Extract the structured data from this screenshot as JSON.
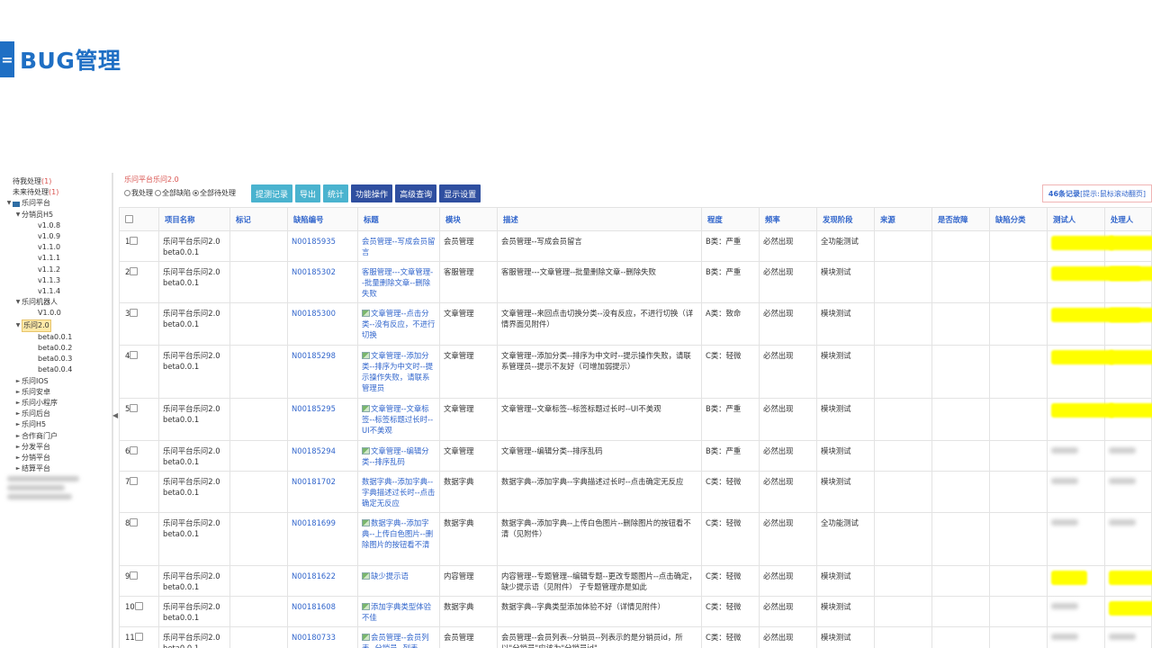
{
  "header": {
    "menu_glyph": "=",
    "title": "BUG管理"
  },
  "tree": {
    "pending_label": "待我处理",
    "pending_count": "(1)",
    "future_label": "未来待处理",
    "future_count": "(1)",
    "root": "乐问平台",
    "g1": "分销员H5",
    "g1_items": [
      "v1.0.8",
      "v1.0.9",
      "v1.1.0",
      "v1.1.1",
      "v1.1.2",
      "v1.1.3",
      "v1.1.4"
    ],
    "g2": "乐问机器人",
    "g2_items": [
      "V1.0.0"
    ],
    "g3": "乐问2.0",
    "g3_items": [
      "beta0.0.1",
      "beta0.0.2",
      "beta0.0.3",
      "beta0.0.4"
    ],
    "others": [
      "乐问IOS",
      "乐问安卓",
      "乐问小程序",
      "乐问后台",
      "乐问H5",
      "合作商门户",
      "分发平台",
      "分销平台",
      "结算平台"
    ]
  },
  "toolbar": {
    "breadcrumb": "乐问平台乐问2.0",
    "radio_mine": "我处理",
    "radio_all_bugs": "全部缺陷",
    "radio_all_pending": "全部待处理",
    "btn_history": "提测记录",
    "btn_export": "导出",
    "btn_stats": "统计",
    "btn_func": "功能操作",
    "btn_advanced": "高级查询",
    "btn_display": "显示设置",
    "records_count": "46条记录",
    "records_hint": "[提示:鼠标滚动翻页]"
  },
  "table": {
    "columns": [
      "项目名称",
      "标记",
      "缺陷编号",
      "标题",
      "模块",
      "描述",
      "程度",
      "频率",
      "发现阶段",
      "来源",
      "是否故障",
      "缺陷分类",
      "测试人",
      "处理人"
    ],
    "rows": [
      {
        "no": "1",
        "project": "乐问平台乐问2.0 beta0.0.1",
        "id": "N00185935",
        "title": "会员管理--写成会员留言",
        "attach": false,
        "module": "会员管理",
        "desc": "会员管理--写成会员留言",
        "level": "B类：严重",
        "freq": "必然出现",
        "stage": "全功能测试"
      },
      {
        "no": "2",
        "project": "乐问平台乐问2.0 beta0.0.1",
        "id": "N00185302",
        "title": "客服管理---文章管理--批量删除文章--删除失败",
        "attach": false,
        "module": "客服管理",
        "desc": "客服管理---文章管理--批量删除文章--删除失败",
        "level": "B类：严重",
        "freq": "必然出现",
        "stage": "模块测试"
      },
      {
        "no": "3",
        "project": "乐问平台乐问2.0 beta0.0.1",
        "id": "N00185300",
        "title": "文章管理--点击分类--没有反应，不进行切换",
        "attach": true,
        "module": "文章管理",
        "desc": "文章管理--来回点击切换分类--没有反应，不进行切换（详情界面见附件）",
        "level": "A类：致命",
        "freq": "必然出现",
        "stage": "模块测试"
      },
      {
        "no": "4",
        "project": "乐问平台乐问2.0 beta0.0.1",
        "id": "N00185298",
        "title": "文章管理--添加分类--排序为中文时--提示操作失败，请联系管理员",
        "attach": true,
        "module": "文章管理",
        "desc": "文章管理--添加分类--排序为中文时--提示操作失败，请联系管理员--提示不友好（可增加弱提示）",
        "level": "C类：轻微",
        "freq": "必然出现",
        "stage": "模块测试"
      },
      {
        "no": "5",
        "project": "乐问平台乐问2.0 beta0.0.1",
        "id": "N00185295",
        "title": "文章管理--文章标签--标签标题过长时--UI不美观",
        "attach": true,
        "module": "文章管理",
        "desc": "文章管理--文章标签--标签标题过长时--UI不美观",
        "level": "B类：严重",
        "freq": "必然出现",
        "stage": "模块测试"
      },
      {
        "no": "6",
        "project": "乐问平台乐问2.0 beta0.0.1",
        "id": "N00185294",
        "title": "文章管理--编辑分类--排序乱码",
        "attach": true,
        "module": "文章管理",
        "desc": "文章管理--编辑分类--排序乱码",
        "level": "B类：严重",
        "freq": "必然出现",
        "stage": "模块测试"
      },
      {
        "no": "7",
        "project": "乐问平台乐问2.0 beta0.0.1",
        "id": "N00181702",
        "title": "数据字典--添加字典--字典描述过长时--点击确定无反应",
        "attach": false,
        "module": "数据字典",
        "desc": "数据字典--添加字典--字典描述过长时--点击确定无反应",
        "level": "C类：轻微",
        "freq": "必然出现",
        "stage": "模块测试"
      },
      {
        "no": "8",
        "project": "乐问平台乐问2.0 beta0.0.1",
        "id": "N00181699",
        "title": "数据字典--添加字典--上传白色图片--删除图片的按钮看不清",
        "attach": true,
        "module": "数据字典",
        "desc": "数据字典--添加字典--上传白色图片--删除图片的按钮看不清（见附件）",
        "level": "C类：轻微",
        "freq": "必然出现",
        "stage": "全功能测试"
      },
      {
        "no": "9",
        "project": "乐问平台乐问2.0 beta0.0.1",
        "id": "N00181622",
        "title": "缺少提示语",
        "attach": true,
        "module": "内容管理",
        "desc": "内容管理--专题管理--编辑专题--更改专题图片--点击确定，缺少提示语（见附件） 子专题管理亦是如此",
        "level": "C类：轻微",
        "freq": "必然出现",
        "stage": "模块测试"
      },
      {
        "no": "10",
        "project": "乐问平台乐问2.0 beta0.0.1",
        "id": "N00181608",
        "title": "添加字典类型体验不佳",
        "attach": true,
        "module": "数据字典",
        "desc": "数据字典--字典类型添加体验不好（详情见附件）",
        "level": "C类：轻微",
        "freq": "必然出现",
        "stage": "模块测试"
      },
      {
        "no": "11",
        "project": "乐问平台乐问2.0 beta0.0.1",
        "id": "N00180733",
        "title": "会员管理--会员列表--分销员--列表",
        "attach": true,
        "module": "会员管理",
        "desc": "会员管理--会员列表--分销员--列表示的是分销员id，所以\"分销员\"应该为\"分销员id\"",
        "level": "C类：轻微",
        "freq": "必然出现",
        "stage": "模块测试"
      }
    ]
  },
  "colors": {
    "brand": "#1f6fc4",
    "link": "#3266cc",
    "danger": "#d9534f",
    "highlight": "#ffff00"
  }
}
